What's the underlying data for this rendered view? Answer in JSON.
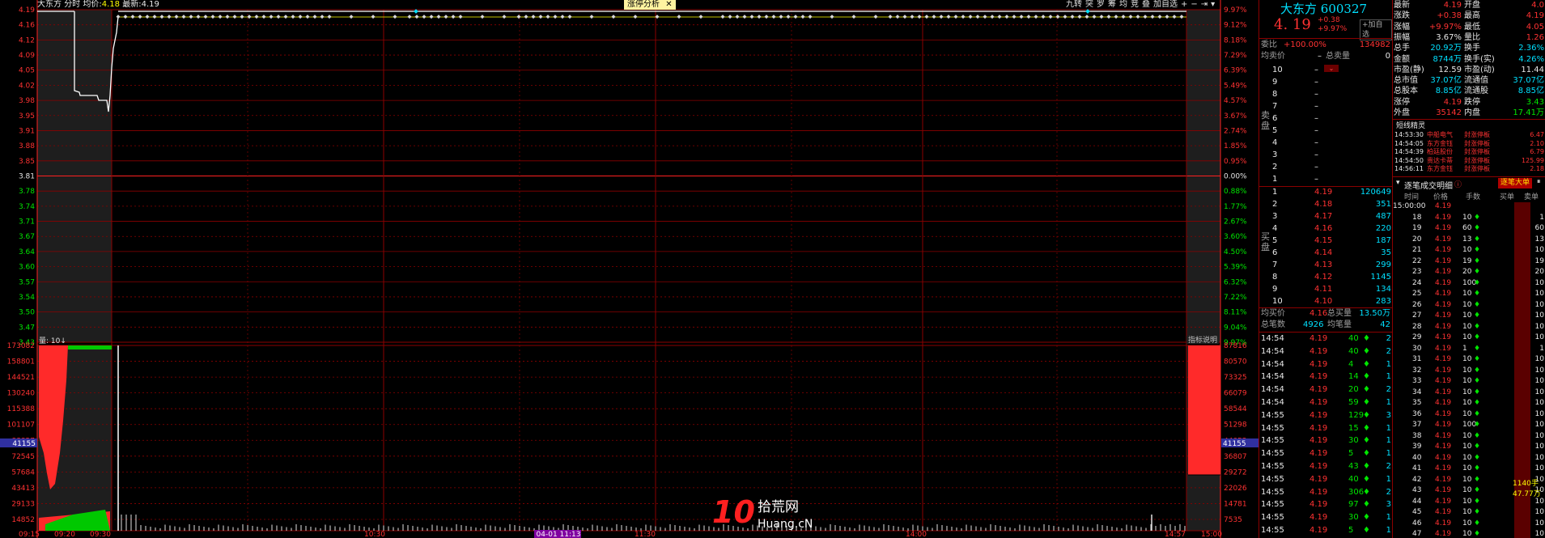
{
  "header": {
    "stock_name": "大东方",
    "mode": "分时",
    "avg_label": "均价:",
    "avg_value": "4.18",
    "latest_label": "最新:",
    "latest_value": "4.19",
    "analysis_tab": "涨停分析",
    "close_glyph": "✕",
    "toolbar": [
      "九转",
      "突",
      "罗",
      "筹",
      "均",
      "竞",
      "叠",
      "加自选"
    ],
    "arrow_icons": [
      "+",
      "−",
      "⇥",
      "▾"
    ]
  },
  "price_axis": {
    "left_ticks": [
      "4.19",
      "4.16",
      "4.12",
      "4.09",
      "4.05",
      "4.02",
      "3.98",
      "3.95",
      "3.91",
      "3.88",
      "3.85",
      "3.81",
      "3.78",
      "3.74",
      "3.71",
      "3.67",
      "3.64",
      "3.60",
      "3.57",
      "3.54",
      "3.50",
      "3.47",
      "3.43"
    ],
    "right_ticks": [
      "9.97%",
      "9.12%",
      "8.18%",
      "7.29%",
      "6.39%",
      "5.49%",
      "4.57%",
      "3.67%",
      "2.74%",
      "1.85%",
      "0.95%",
      "0.00%",
      "0.88%",
      "1.77%",
      "2.67%",
      "3.60%",
      "4.50%",
      "5.39%",
      "6.32%",
      "7.22%",
      "8.11%",
      "9.04%",
      "9.97%"
    ],
    "base_price": "3.81",
    "base_pct": "0.00%"
  },
  "volume_axis": {
    "label": "量: 10↓",
    "left_ticks": [
      "173082",
      "158801",
      "144521",
      "130240",
      "115388",
      "101107",
      "88827",
      "72545",
      "57684",
      "43413",
      "29133",
      "14852"
    ],
    "right_ticks": [
      "87816",
      "80570",
      "73325",
      "66079",
      "58544",
      "51298",
      "44052",
      "36807",
      "29272",
      "22026",
      "14781",
      "7535"
    ],
    "marker_value": "41155",
    "indicator_label": "指标说明"
  },
  "time_axis": {
    "labels": [
      "09:15",
      "09:20",
      "09:30",
      "10:30",
      "04-01 11:13",
      "11:30",
      "14:00",
      "14:57",
      "15:00"
    ]
  },
  "watermark": {
    "num": "10",
    "cn": "拾荒网",
    "en": "Huang.cN"
  },
  "quote": {
    "name": "大东方",
    "code": "600327",
    "price": "4. 19",
    "change": "+0.38",
    "change_pct": "+9.97%",
    "add_watch": "+加自选",
    "weibi_label": "委比",
    "weibi_value": "+100.00%",
    "weicha_value": "134982",
    "avg_sell_label": "均卖价",
    "total_sell_label": "总卖量",
    "total_sell_value": "0",
    "sell_side_label": "卖盘",
    "buy_side_label": "买盘",
    "sell_levels": [
      {
        "n": "10",
        "p": "–",
        "v": ""
      },
      {
        "n": "9",
        "p": "–",
        "v": ""
      },
      {
        "n": "8",
        "p": "–",
        "v": ""
      },
      {
        "n": "7",
        "p": "–",
        "v": ""
      },
      {
        "n": "6",
        "p": "–",
        "v": ""
      },
      {
        "n": "5",
        "p": "–",
        "v": ""
      },
      {
        "n": "4",
        "p": "–",
        "v": ""
      },
      {
        "n": "3",
        "p": "–",
        "v": ""
      },
      {
        "n": "2",
        "p": "–",
        "v": ""
      },
      {
        "n": "1",
        "p": "–",
        "v": ""
      }
    ],
    "buy_levels": [
      {
        "n": "1",
        "p": "4.19",
        "v": "120649"
      },
      {
        "n": "2",
        "p": "4.18",
        "v": "351"
      },
      {
        "n": "3",
        "p": "4.17",
        "v": "487"
      },
      {
        "n": "4",
        "p": "4.16",
        "v": "220"
      },
      {
        "n": "5",
        "p": "4.15",
        "v": "187"
      },
      {
        "n": "6",
        "p": "4.14",
        "v": "35"
      },
      {
        "n": "7",
        "p": "4.13",
        "v": "299"
      },
      {
        "n": "8",
        "p": "4.12",
        "v": "1145"
      },
      {
        "n": "9",
        "p": "4.11",
        "v": "134"
      },
      {
        "n": "10",
        "p": "4.10",
        "v": "283"
      }
    ],
    "avg_buy_label": "均买价",
    "avg_buy_value": "4.16",
    "total_buy_label": "总买量",
    "total_buy_value": "13.50万",
    "total_deals_label": "总笔数",
    "total_deals_value": "4926",
    "avg_deal_label": "均笔量",
    "avg_deal_value": "42"
  },
  "ticks": [
    {
      "t": "14:54",
      "p": "4.19",
      "v": "40",
      "n": "2"
    },
    {
      "t": "14:54",
      "p": "4.19",
      "v": "40",
      "n": "2"
    },
    {
      "t": "14:54",
      "p": "4.19",
      "v": "4",
      "n": "1"
    },
    {
      "t": "14:54",
      "p": "4.19",
      "v": "14",
      "n": "1"
    },
    {
      "t": "14:54",
      "p": "4.19",
      "v": "20",
      "n": "2"
    },
    {
      "t": "14:54",
      "p": "4.19",
      "v": "59",
      "n": "1"
    },
    {
      "t": "14:55",
      "p": "4.19",
      "v": "129",
      "n": "3"
    },
    {
      "t": "14:55",
      "p": "4.19",
      "v": "15",
      "n": "1"
    },
    {
      "t": "14:55",
      "p": "4.19",
      "v": "30",
      "n": "1"
    },
    {
      "t": "14:55",
      "p": "4.19",
      "v": "5",
      "n": "1"
    },
    {
      "t": "14:55",
      "p": "4.19",
      "v": "43",
      "n": "2"
    },
    {
      "t": "14:55",
      "p": "4.19",
      "v": "40",
      "n": "1"
    },
    {
      "t": "14:55",
      "p": "4.19",
      "v": "306",
      "n": "2"
    },
    {
      "t": "14:55",
      "p": "4.19",
      "v": "97",
      "n": "3"
    },
    {
      "t": "14:55",
      "p": "4.19",
      "v": "30",
      "n": "1"
    },
    {
      "t": "14:55",
      "p": "4.19",
      "v": "5",
      "n": "1"
    }
  ],
  "stats": [
    {
      "l1": "最新",
      "v1": "4.19",
      "c1": "red",
      "l2": "开盘",
      "v2": "4.0",
      "c2": "red"
    },
    {
      "l1": "涨跌",
      "v1": "+0.38",
      "c1": "red",
      "l2": "最高",
      "v2": "4.19",
      "c2": "red"
    },
    {
      "l1": "涨幅",
      "v1": "+9.97%",
      "c1": "red",
      "l2": "最低",
      "v2": "4.05",
      "c2": "red"
    },
    {
      "l1": "振幅",
      "v1": "3.67%",
      "c1": "wht",
      "l2": "量比",
      "v2": "1.26",
      "c2": "red"
    },
    {
      "l1": "总手",
      "v1": "20.92万",
      "c1": "cyn",
      "l2": "换手",
      "v2": "2.36%",
      "c2": "cyn"
    },
    {
      "l1": "金额",
      "v1": "8744万",
      "c1": "cyn",
      "l2": "换手(实)",
      "v2": "4.26%",
      "c2": "cyn"
    },
    {
      "l1": "市盈(静)",
      "v1": "12.59",
      "c1": "wht",
      "l2": "市盈(动)",
      "v2": "11.44",
      "c2": "wht"
    },
    {
      "l1": "总市值",
      "v1": "37.07亿",
      "c1": "cyn",
      "l2": "流通值",
      "v2": "37.07亿",
      "c2": "cyn"
    },
    {
      "l1": "总股本",
      "v1": "8.85亿",
      "c1": "cyn",
      "l2": "流通股",
      "v2": "8.85亿",
      "c2": "cyn"
    },
    {
      "l1": "涨停",
      "v1": "4.19",
      "c1": "red",
      "l2": "跌停",
      "v2": "3.43",
      "c2": "grn"
    },
    {
      "l1": "外盘",
      "v1": "35142",
      "c1": "red",
      "l2": "内盘",
      "v2": "17.41万",
      "c2": "grn"
    }
  ],
  "short_term": {
    "title": "短线精灵",
    "items": [
      {
        "t": "14:53:30",
        "name": "中船电气",
        "ev": "封涨停板",
        "val": "6.47"
      },
      {
        "t": "14:54:05",
        "name": "东方金钰",
        "ev": "封涨停板",
        "val": "2.10"
      },
      {
        "t": "14:54:39",
        "name": "柏廷股份",
        "ev": "封涨停板",
        "val": "6.79"
      },
      {
        "t": "14:54:50",
        "name": "贵达卡蒂",
        "ev": "封涨停板",
        "val": "125.99"
      },
      {
        "t": "14:56:11",
        "name": "东方金钰",
        "ev": "封涨停板",
        "val": "2.18"
      }
    ]
  },
  "deals": {
    "title": "逐笔成交明细",
    "big_order_button": "逐笔大单",
    "headers": [
      "时间",
      "价格",
      "手数",
      "买单",
      "卖单"
    ],
    "first_time": "15:00:00",
    "price": "4.19",
    "rows": [
      {
        "n": "18",
        "v": "10",
        "a": "1"
      },
      {
        "n": "19",
        "v": "60",
        "a": "60"
      },
      {
        "n": "20",
        "v": "13",
        "a": "13"
      },
      {
        "n": "21",
        "v": "10",
        "a": "10"
      },
      {
        "n": "22",
        "v": "19",
        "a": "19"
      },
      {
        "n": "23",
        "v": "20",
        "a": "20"
      },
      {
        "n": "24",
        "v": "100",
        "a": "10"
      },
      {
        "n": "25",
        "v": "10",
        "a": "10"
      },
      {
        "n": "26",
        "v": "10",
        "a": "10"
      },
      {
        "n": "27",
        "v": "10",
        "a": "10"
      },
      {
        "n": "28",
        "v": "10",
        "a": "10"
      },
      {
        "n": "29",
        "v": "10",
        "a": "10"
      },
      {
        "n": "30",
        "v": "1",
        "a": "1"
      },
      {
        "n": "31",
        "v": "10",
        "a": "10"
      },
      {
        "n": "32",
        "v": "10",
        "a": "10"
      },
      {
        "n": "33",
        "v": "10",
        "a": "10"
      },
      {
        "n": "34",
        "v": "10",
        "a": "10"
      },
      {
        "n": "35",
        "v": "10",
        "a": "10"
      },
      {
        "n": "36",
        "v": "10",
        "a": "10"
      },
      {
        "n": "37",
        "v": "100",
        "a": "10"
      },
      {
        "n": "38",
        "v": "10",
        "a": "10"
      },
      {
        "n": "39",
        "v": "10",
        "a": "10"
      },
      {
        "n": "40",
        "v": "10",
        "a": "10"
      },
      {
        "n": "41",
        "v": "10",
        "a": "10"
      },
      {
        "n": "42",
        "v": "10",
        "a": "10"
      },
      {
        "n": "43",
        "v": "10",
        "a": "10"
      },
      {
        "n": "44",
        "v": "10",
        "a": "10"
      },
      {
        "n": "45",
        "v": "10",
        "a": "10"
      },
      {
        "n": "46",
        "v": "10",
        "a": "10"
      },
      {
        "n": "47",
        "v": "10",
        "a": "10"
      }
    ],
    "big_note_1": "1140手",
    "big_note_2": "47.77万"
  },
  "colors": {
    "up": "#ff3232",
    "down": "#00e600",
    "grid": "#8b0000",
    "price_line": "#ffffff",
    "avg_line": "#ffff00"
  }
}
